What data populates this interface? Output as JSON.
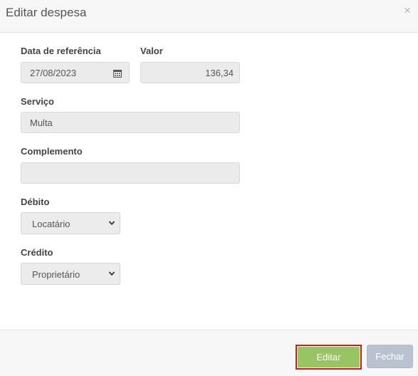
{
  "dialog": {
    "title": "Editar despesa",
    "close_glyph": "×"
  },
  "form": {
    "data_referencia": {
      "label": "Data de referência",
      "value": "27/08/2023",
      "icon": "calendar-icon"
    },
    "valor": {
      "label": "Valor",
      "value": "136,34"
    },
    "servico": {
      "label": "Serviço",
      "value": "Multa"
    },
    "complemento": {
      "label": "Complemento",
      "value": ""
    },
    "debito": {
      "label": "Débito",
      "selected": "Locatário"
    },
    "credito": {
      "label": "Crédito",
      "selected": "Proprietário"
    }
  },
  "footer": {
    "edit_label": "Editar",
    "close_label": "Fechar"
  },
  "colors": {
    "edit_button": "#98c463",
    "edit_highlight_border": "#d4190f",
    "close_button": "#b9c3d0"
  }
}
